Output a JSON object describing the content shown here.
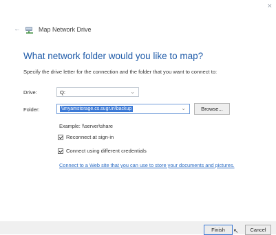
{
  "window": {
    "title": "Map Network Drive",
    "close_glyph": "×"
  },
  "page": {
    "heading": "What network folder would you like to map?",
    "instruction": "Specify the drive letter for the connection and the folder that you want to connect to:"
  },
  "form": {
    "drive_label": "Drive:",
    "drive_value": "Q:",
    "folder_label": "Folder:",
    "folder_value": "\\\\myamstorage.cs.sugr.in\\backup",
    "browse_label": "Browse...",
    "example": "Example: \\\\server\\share",
    "reconnect_label": "Reconnect at sign-in",
    "reconnect_checked": true,
    "credentials_label": "Connect using different credentials",
    "credentials_checked": true,
    "web_link": "Connect to a Web site that you can use to store your documents and pictures."
  },
  "buttons": {
    "finish": "Finish",
    "cancel": "Cancel"
  },
  "colors": {
    "heading": "#1e5aa8",
    "selection": "#3b79d6",
    "link": "#2b6cc4",
    "footer": "#f0f0f0"
  },
  "icons": {
    "back": "back-arrow-icon",
    "drive": "network-drive-icon",
    "close": "close-icon",
    "caret": "chevron-down-icon",
    "cursor": "mouse-pointer-icon"
  }
}
